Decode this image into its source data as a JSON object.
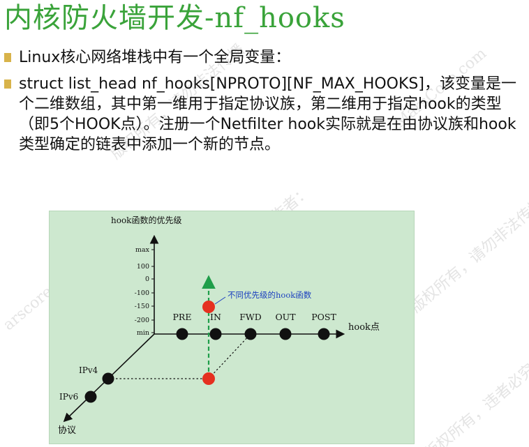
{
  "slide": {
    "title": "内核防火墙开发-nf_hooks",
    "bullets": [
      {
        "text": "Linux核心网络堆栈中有一个全局变量："
      },
      {
        "text": "struct list_head nf_hooks[NPROTO][NF_MAX_HOOKS]，该变量是一个二维数组，其中第一维用于指定协议族，第二维用于指定hook的类型（即5个HOOK点）。注册一个Netfilter hook实际就是在由协议族和hook类型确定的链表中添加一个新的节点。"
      }
    ]
  },
  "diagram": {
    "y_axis_label": "hook函数的优先级",
    "y_ticks": [
      "max",
      "100",
      "0",
      "-100",
      "-150",
      "-200",
      "min"
    ],
    "x_axis_label": "hook点",
    "hook_points": [
      "PRE",
      "IN",
      "FWD",
      "OUT",
      "POST"
    ],
    "z_axis_label": "协议",
    "protocols": [
      "IPv4",
      "IPv6"
    ],
    "annotation": "不同优先级的hook函数",
    "colors": {
      "panel_bg": "#cde8cf",
      "node": "#111111",
      "highlight_node": "#e53020",
      "priority_arrow": "#1f9e4a",
      "annotation_text": "#1a3fbf"
    }
  }
}
